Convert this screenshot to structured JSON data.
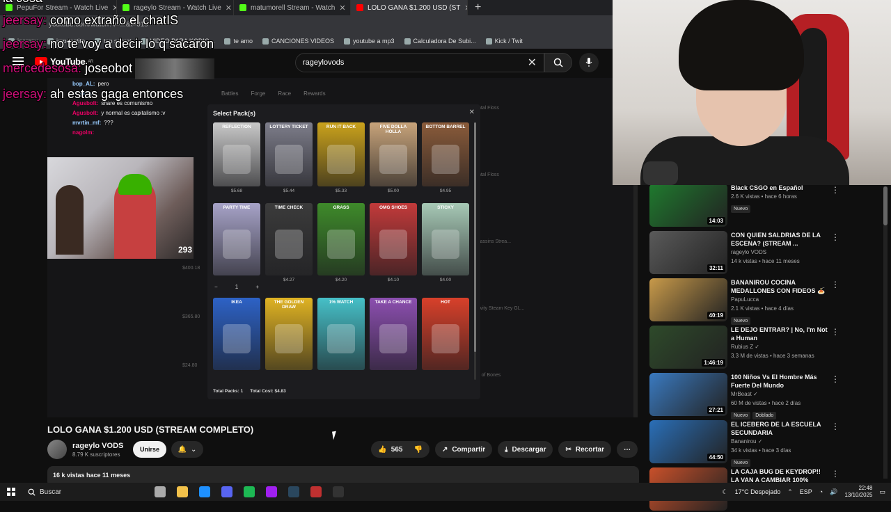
{
  "browser": {
    "tabs": [
      {
        "label": "PepuFor Stream - Watch Live",
        "color": "#53fc18",
        "active": false
      },
      {
        "label": "rageylo Stream - Watch Live",
        "color": "#53fc18",
        "active": false
      },
      {
        "label": "matumorell Stream - Watch",
        "color": "#53fc18",
        "active": false
      },
      {
        "label": "LOLO GANA $1.200 USD (ST",
        "color": "#ff0000",
        "active": true
      }
    ],
    "address": "youtube.com/watch?v=...&t=01s",
    "bookmarks": [
      "jeersay",
      "impuestito",
      "top secret",
      "VIDEO PARA KODIG...",
      "te amo",
      "CANCIONES VIDEOS",
      "youtube a mp3",
      "Calculadora De Subi...",
      "Kick / Twit"
    ]
  },
  "youtube": {
    "logo": "YouTube",
    "region": "AR",
    "search_value": "rageylovods"
  },
  "stream_overlay": {
    "nav": [
      "Battles",
      "Forge",
      "Race",
      "Rewards"
    ],
    "chat": [
      {
        "user": "bop_AL:",
        "text": "pero",
        "g": true
      },
      {
        "user": "Nightbot:",
        "text": "",
        "g": true
      },
      {
        "user": "Agusbolt:",
        "text": "share es comunismo",
        "g": false
      },
      {
        "user": "Agusbolt:",
        "text": "y normal es capitalismo :v",
        "g": false
      },
      {
        "user": "mvrtin_mf:",
        "text": "???",
        "g": true
      },
      {
        "user": "nagolm:",
        "text": "",
        "g": false
      }
    ],
    "viewer_count": "293",
    "side_items": [
      "Dental Floss",
      "Dental Floss",
      "Assassins Strea...",
      "Gravity Steam Key GL...",
      "Pile of Bones"
    ],
    "side_prices": [
      "$400.18",
      "$365.80",
      "$24.80"
    ],
    "modal": {
      "title": "Select Pack(s)",
      "rows": [
        [
          {
            "name": "REFLECTION",
            "price": "$5.68",
            "color": "#c9c9c9"
          },
          {
            "name": "LOTTERY TICKET",
            "price": "$5.44",
            "color": "#7d7d8a"
          },
          {
            "name": "RUN IT BACK",
            "price": "$5.33",
            "color": "#caa21c"
          },
          {
            "name": "FIVE DOLLA HOLLA",
            "price": "$5.00",
            "color": "#c7a37a"
          },
          {
            "name": "BOTTOM BARREL",
            "price": "$4.95",
            "color": "#8a5b3a"
          }
        ],
        [
          {
            "name": "PARTY TIME",
            "price": "",
            "color": "#a7a3c8"
          },
          {
            "name": "TIME CHECK",
            "price": "$4.27",
            "color": "#3b3b3b"
          },
          {
            "name": "GRASS",
            "price": "$4.20",
            "color": "#3e8a2a"
          },
          {
            "name": "OMG SHOES",
            "price": "$4.10",
            "color": "#c23a3a"
          },
          {
            "name": "STICKY",
            "price": "$4.00",
            "color": "#a7c9b6"
          }
        ],
        [
          {
            "name": "IKEA",
            "price": "",
            "color": "#2d62c6"
          },
          {
            "name": "THE GOLDEN DRAW",
            "price": "",
            "color": "#e0b323"
          },
          {
            "name": "1% WATCH",
            "price": "",
            "color": "#46c0c8"
          },
          {
            "name": "TAKE A CHANCE",
            "price": "",
            "color": "#8c4fb0"
          },
          {
            "name": "HOT",
            "price": "",
            "color": "#d8402a"
          }
        ]
      ],
      "qty": {
        "minus": "−",
        "value": "1",
        "plus": "+"
      },
      "total_packs": "Total Packs: 1",
      "total_cost": "Total Cost: $4.83"
    }
  },
  "video": {
    "title": "LOLO GANA $1.200 USD (STREAM COMPLETO)",
    "channel": "rageylo VODS",
    "subscribers": "8.79 K suscriptores",
    "join": "Unirse",
    "likes": "565",
    "share": "Compartir",
    "download": "Descargar",
    "clip": "Recortar",
    "desc_meta": "16 k vistas  hace 11 meses"
  },
  "recommendations": [
    {
      "title": "Black CSGO en Español",
      "channel": "",
      "meta": "2.6 K vistas • hace 6 horas",
      "dur": "14:03",
      "tags": [
        "Nuevo"
      ],
      "thumb": "#1f7a2e",
      "verified": true
    },
    {
      "title": "CON QUIEN SALDRIAS DE LA ESCENA? (STREAM ...",
      "channel": "rageylo VODS",
      "meta": "14 k vistas • hace 11 meses",
      "dur": "32:11",
      "tags": [],
      "thumb": "#5a5a5a",
      "verified": false
    },
    {
      "title": "BANANIROU COCINA MEDALLONES CON FIDEOS 🍝",
      "channel": "PapuLucca",
      "meta": "2.1 K vistas • hace 4 días",
      "dur": "40:19",
      "tags": [
        "Nuevo"
      ],
      "thumb": "#c89a4a",
      "verified": false
    },
    {
      "title": "LE DEJO ENTRAR? | No, I'm Not a Human",
      "channel": "Rubius Z",
      "meta": "3.3 M de vistas • hace 3 semanas",
      "dur": "1:46:19",
      "tags": [],
      "thumb": "#2e4a2a",
      "verified": true
    },
    {
      "title": "100 Niños Vs El Hombre Más Fuerte Del Mundo",
      "channel": "MrBeast",
      "meta": "60 M de vistas • hace 2 días",
      "dur": "27:21",
      "tags": [
        "Nuevo",
        "Doblado"
      ],
      "thumb": "#3a7ac0",
      "verified": true
    },
    {
      "title": "EL ICEBERG DE LA ESCUELA SECUNDARIA",
      "channel": "Bananirou",
      "meta": "34 k vistas • hace 3 días",
      "dur": "44:50",
      "tags": [
        "Nuevo"
      ],
      "thumb": "#2a6fb8",
      "verified": true
    },
    {
      "title": "LA CAJA BUG DE KEYDROP!! LA VAN A CAMBIAR 100%",
      "channel": "",
      "meta": "",
      "dur": "",
      "tags": [],
      "thumb": "#c8502a",
      "verified": false
    }
  ],
  "chat_overlay": [
    {
      "user": "",
      "text": "la cosa"
    },
    {
      "user": "jeersay:",
      "text": " como extraño el chatIS"
    },
    {
      "user": "jeersay:",
      "text": " no te voy a decir lo q sacaron"
    },
    {
      "user": "mercedesosa:",
      "text": " joseobot",
      "emote": true
    },
    {
      "user": "jeersay:",
      "text": " ah estas gaga entonces"
    }
  ],
  "taskbar": {
    "search": "Buscar",
    "weather": "17°C  Despejado",
    "lang": "ESP",
    "time": "22:48",
    "date": "13/10/2025",
    "icon_colors": [
      "#aaa",
      "#f2c14a",
      "#1e90ff",
      "#5865f2",
      "#1db954",
      "#a020f0",
      "#2a475e",
      "#c03030",
      "#333"
    ]
  }
}
